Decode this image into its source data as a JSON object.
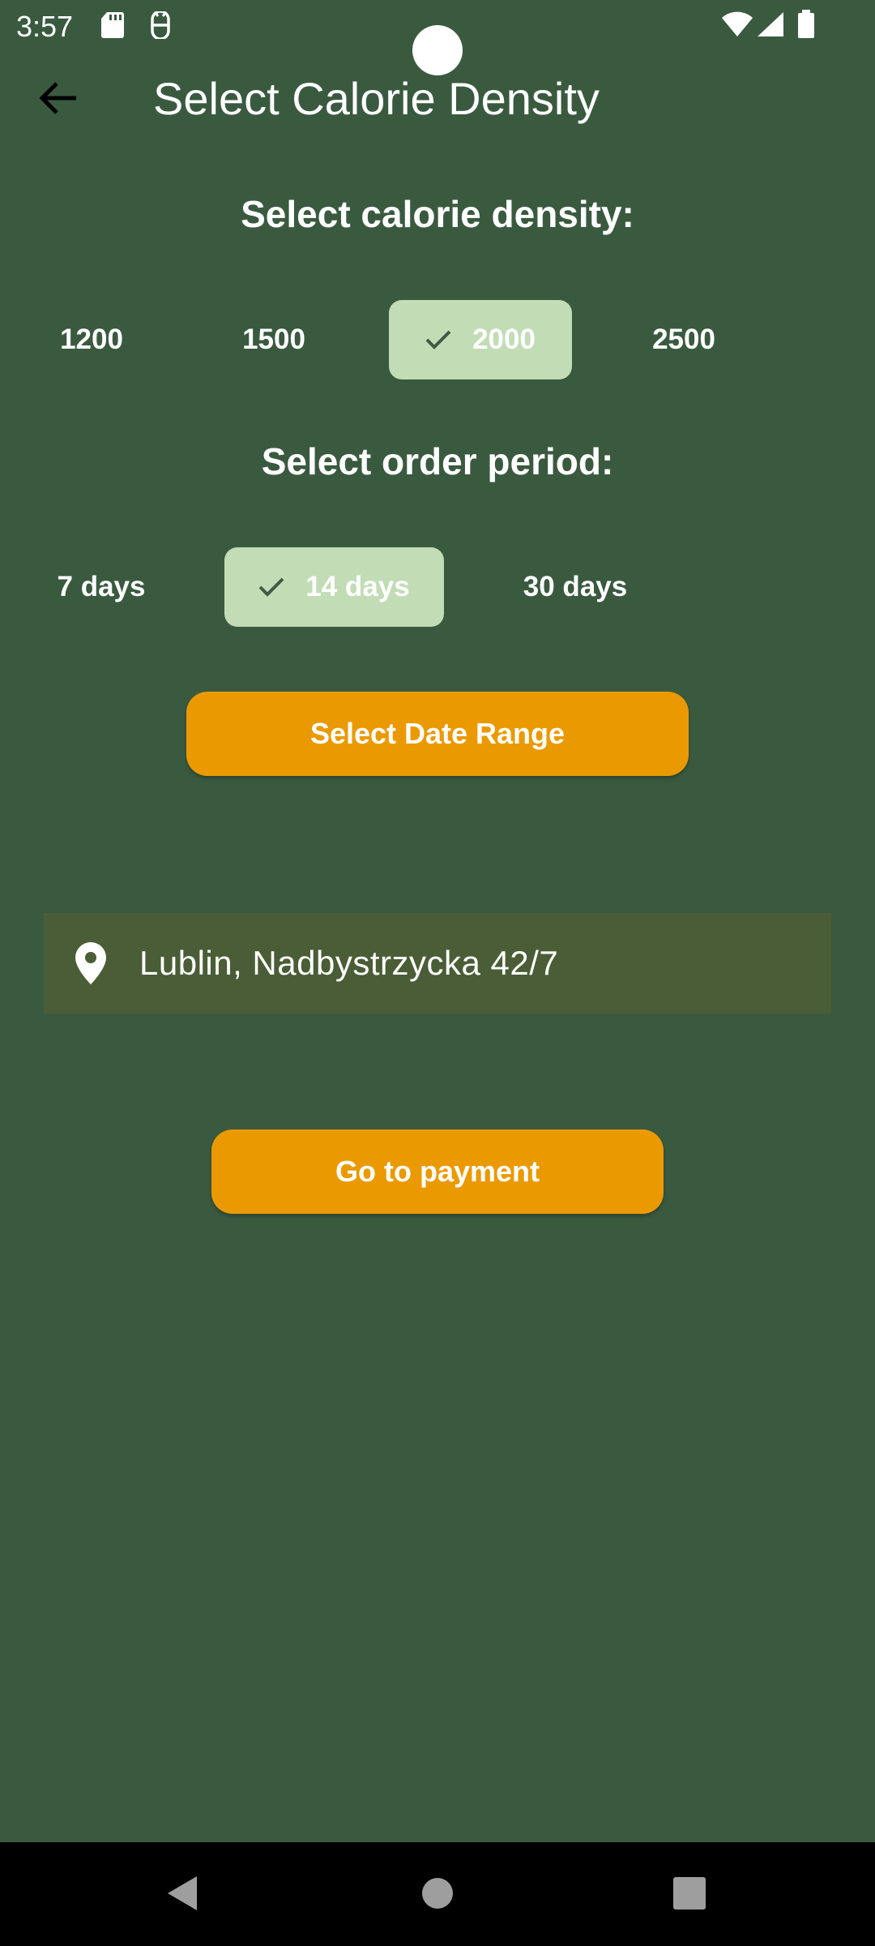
{
  "status_bar": {
    "time": "3:57",
    "left_icons": [
      "sd-card-icon",
      "debug-icon"
    ],
    "right_icons": [
      "wifi-icon",
      "signal-icon",
      "battery-icon"
    ]
  },
  "app_bar": {
    "back_icon": "arrow-back-icon",
    "title": "Select Calorie Density"
  },
  "calorie_section": {
    "heading": "Select calorie density:",
    "options": [
      {
        "label": "1200",
        "selected": false
      },
      {
        "label": "1500",
        "selected": false
      },
      {
        "label": "2000",
        "selected": true
      },
      {
        "label": "2500",
        "selected": false
      }
    ]
  },
  "period_section": {
    "heading": "Select order period:",
    "options": [
      {
        "label": "7 days",
        "selected": false
      },
      {
        "label": "14 days",
        "selected": true
      },
      {
        "label": "30 days",
        "selected": false
      }
    ]
  },
  "date_range_button": {
    "label": "Select Date Range"
  },
  "address": {
    "icon": "location-pin-icon",
    "value": "Lublin, Nadbystrzycka 42/7"
  },
  "payment_button": {
    "label": "Go to payment"
  },
  "nav_bar": {
    "icons": [
      "back-triangle-icon",
      "home-circle-icon",
      "recents-square-icon"
    ]
  },
  "colors": {
    "background": "#3a5a40",
    "accent": "#ea9a00",
    "chip_selected": "#c2dcb5",
    "address_field": "#4a5d36"
  }
}
